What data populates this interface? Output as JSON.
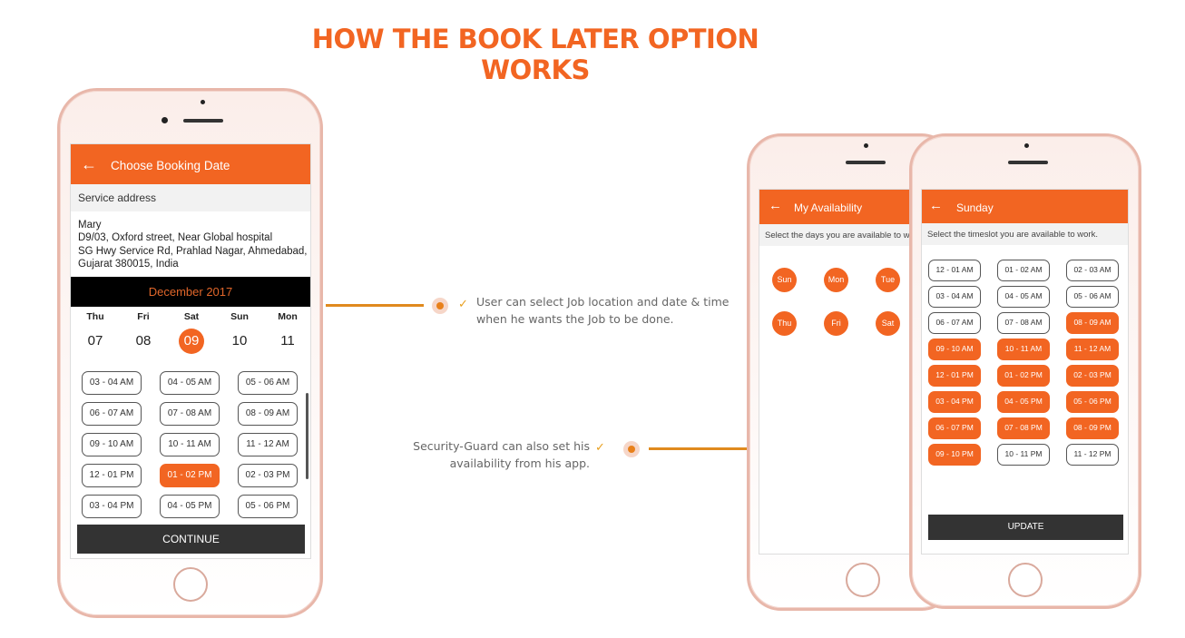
{
  "title": "HOW THE BOOK LATER OPTION WORKS",
  "notes": {
    "user": "User can select Job location and date & time when he wants the Job to be done.",
    "guard": "Security-Guard can also set his availability from his app."
  },
  "accent": "#F26522",
  "booking": {
    "header": "Choose Booking Date",
    "back_icon": "arrow-left",
    "section": "Service address",
    "address": [
      "Mary",
      "D9/03, Oxford street, Near Global hospital",
      "SG Hwy Service Rd, Prahlad Nagar, Ahmedabad,",
      "Gujarat 380015, India"
    ],
    "month": "December 2017",
    "days": [
      {
        "name": "Thu",
        "date": "07"
      },
      {
        "name": "Fri",
        "date": "08"
      },
      {
        "name": "Sat",
        "date": "09",
        "selected": true
      },
      {
        "name": "Sun",
        "date": "10"
      },
      {
        "name": "Mon",
        "date": "11"
      }
    ],
    "slots": [
      {
        "label": "03 - 04 AM"
      },
      {
        "label": "04 - 05 AM"
      },
      {
        "label": "05 - 06 AM"
      },
      {
        "label": "06 - 07 AM"
      },
      {
        "label": "07 - 08 AM"
      },
      {
        "label": "08 - 09 AM"
      },
      {
        "label": "09 - 10 AM"
      },
      {
        "label": "10 - 11 AM"
      },
      {
        "label": "11 - 12 AM"
      },
      {
        "label": "12 - 01 PM"
      },
      {
        "label": "01 - 02 PM",
        "selected": true
      },
      {
        "label": "02 - 03 PM"
      },
      {
        "label": "03 - 04 PM"
      },
      {
        "label": "04 - 05 PM"
      },
      {
        "label": "05 - 06 PM"
      }
    ],
    "continue": "CONTINUE"
  },
  "availability": {
    "header": "My Availability",
    "instruction": "Select the days you are available to w",
    "days": [
      "Sun",
      "Mon",
      "Tue",
      "Thu",
      "Fri",
      "Sat"
    ]
  },
  "sunday": {
    "header": "Sunday",
    "instruction": "Select the timeslot you are available to work.",
    "slots": [
      {
        "label": "12 - 01 AM"
      },
      {
        "label": "01 - 02 AM"
      },
      {
        "label": "02 - 03 AM"
      },
      {
        "label": "03 - 04 AM"
      },
      {
        "label": "04 - 05 AM"
      },
      {
        "label": "05 - 06 AM"
      },
      {
        "label": "06 - 07 AM"
      },
      {
        "label": "07 - 08 AM"
      },
      {
        "label": "08 - 09 AM",
        "selected": true
      },
      {
        "label": "09 - 10 AM",
        "selected": true
      },
      {
        "label": "10 - 11 AM",
        "selected": true
      },
      {
        "label": "11 - 12 AM",
        "selected": true
      },
      {
        "label": "12 - 01 PM",
        "selected": true
      },
      {
        "label": "01 - 02 PM",
        "selected": true
      },
      {
        "label": "02 - 03 PM",
        "selected": true
      },
      {
        "label": "03 - 04 PM",
        "selected": true
      },
      {
        "label": "04 - 05 PM",
        "selected": true
      },
      {
        "label": "05 - 06 PM",
        "selected": true
      },
      {
        "label": "06 - 07 PM",
        "selected": true
      },
      {
        "label": "07 - 08 PM",
        "selected": true
      },
      {
        "label": "08 - 09 PM",
        "selected": true
      },
      {
        "label": "09 - 10 PM",
        "selected": true
      },
      {
        "label": "10 - 11 PM"
      },
      {
        "label": "11 - 12 PM"
      }
    ],
    "update": "UPDATE"
  }
}
